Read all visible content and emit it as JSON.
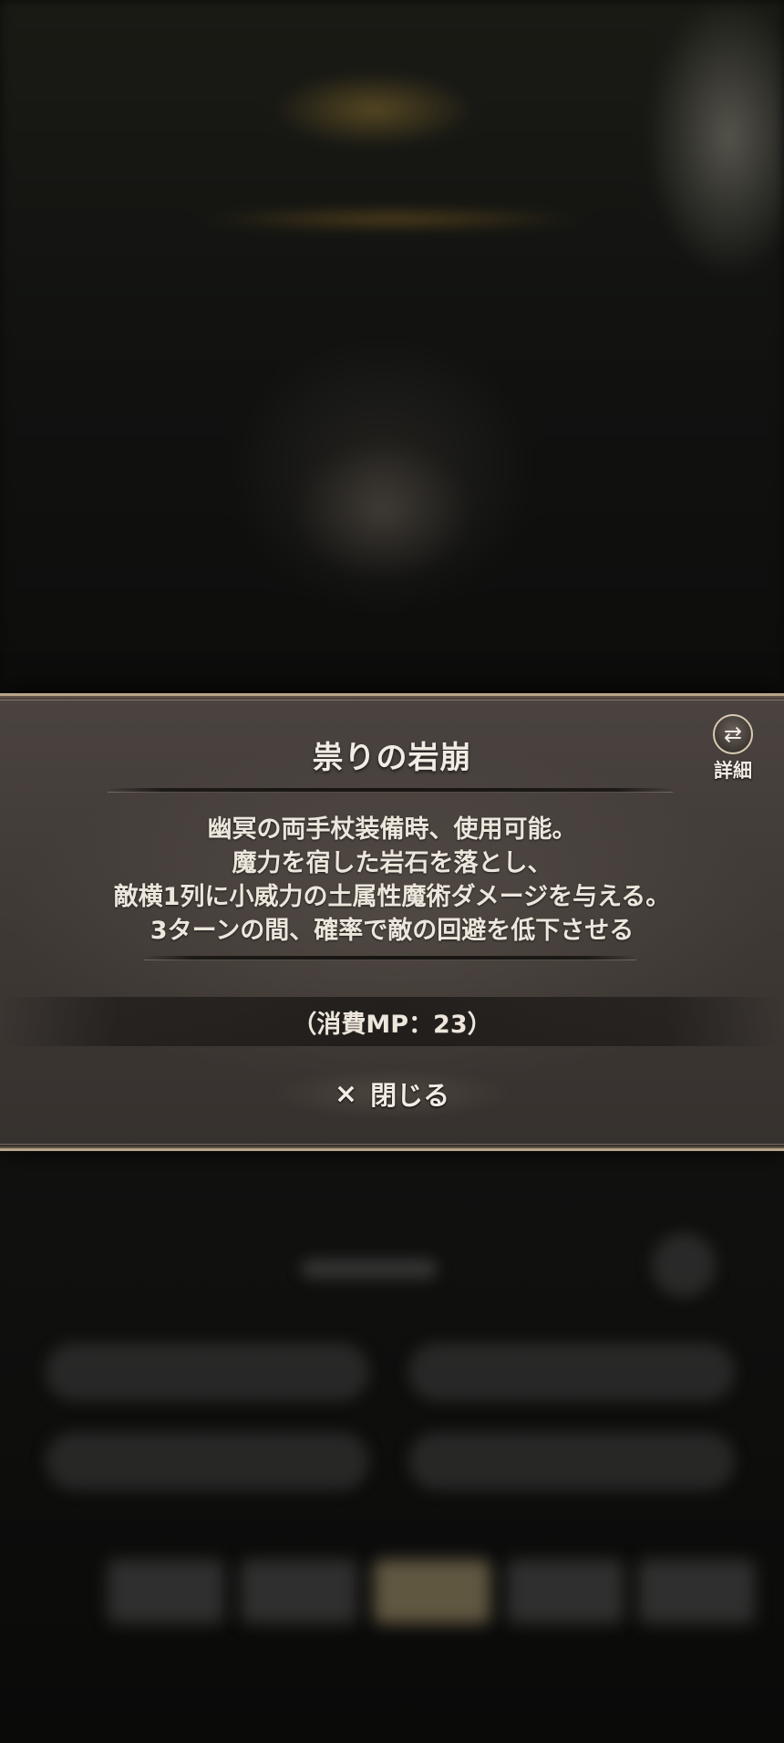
{
  "skill_dialog": {
    "title": "祟りの岩崩",
    "detail_label": "詳細",
    "detail_icon": "swap-icon",
    "description": [
      "幽冥の両手杖装備時、使用可能。",
      "魔力を宿した岩石を落とし、",
      "敵横1列に小威力の土属性魔術ダメージを与える。",
      "3ターンの間、確率で敵の回避を低下させる"
    ],
    "cost": "（消費MP：23）",
    "close_label": "閉じる",
    "close_icon": "×"
  }
}
